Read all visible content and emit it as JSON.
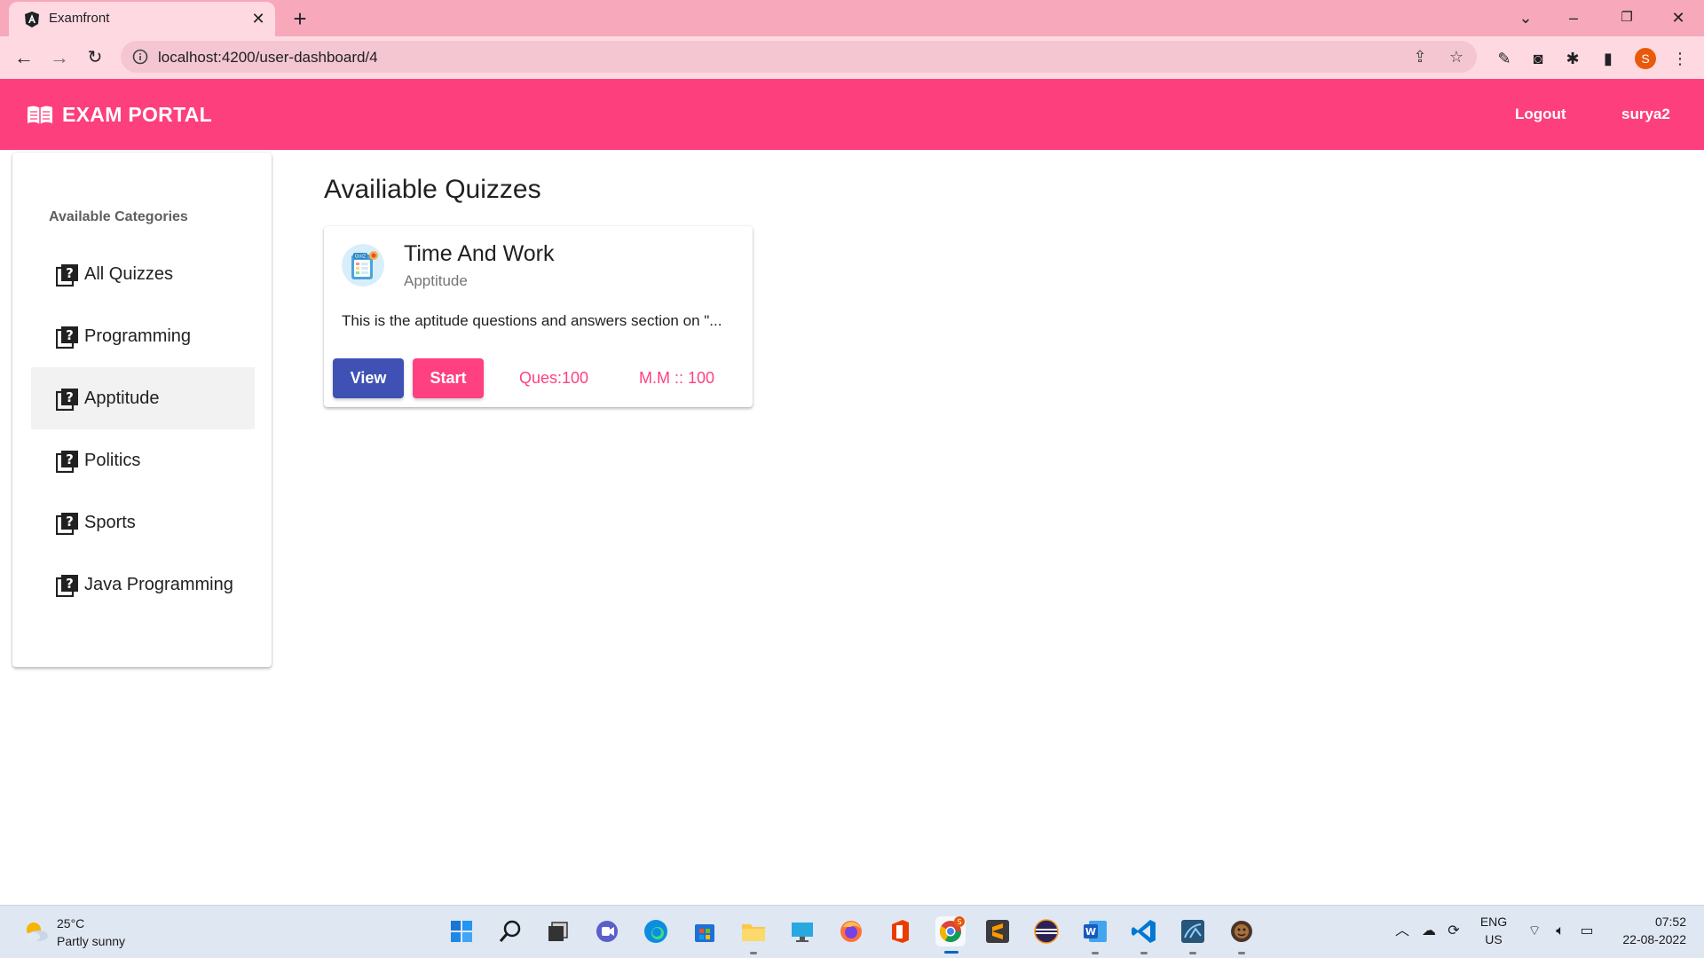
{
  "browser": {
    "tab_title": "Examfront",
    "url": "localhost:4200/user-dashboard/4",
    "profile_initial": "S"
  },
  "header": {
    "brand": "EXAM PORTAL",
    "logout_label": "Logout",
    "username": "surya2",
    "accent_color": "#fd3f7d"
  },
  "sidebar": {
    "heading": "Available Categories",
    "items": [
      {
        "label": "All Quizzes",
        "active": false
      },
      {
        "label": "Programming",
        "active": false
      },
      {
        "label": "Apptitude",
        "active": true
      },
      {
        "label": "Politics",
        "active": false
      },
      {
        "label": "Sports",
        "active": false
      },
      {
        "label": "Java Programming",
        "active": false
      }
    ]
  },
  "main": {
    "title": "Availiable Quizzes",
    "quizzes": [
      {
        "title": "Time And Work",
        "category": "Apptitude",
        "description": "This is the aptitude questions and answers section on \"...",
        "view_label": "View",
        "start_label": "Start",
        "questions": "Ques:100",
        "max_marks": "M.M :: 100"
      }
    ]
  },
  "taskbar": {
    "weather_temp": "25°C",
    "weather_desc": "Partly sunny",
    "language": "ENG",
    "region": "US",
    "time": "07:52",
    "date": "22-08-2022",
    "chrome_badge": "S"
  }
}
